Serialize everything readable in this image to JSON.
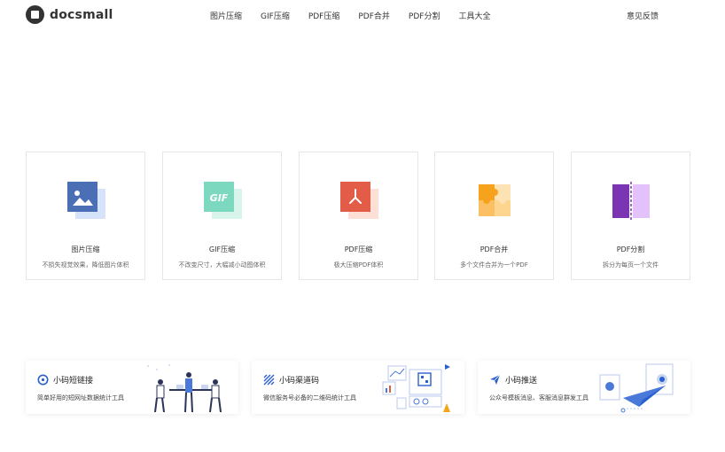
{
  "header": {
    "logo_text": "docsmall",
    "nav": [
      "图片压缩",
      "GIF压缩",
      "PDF压缩",
      "PDF合并",
      "PDF分割",
      "工具大全"
    ],
    "feedback": "意见反馈"
  },
  "tools": [
    {
      "title": "图片压缩",
      "desc": "不损失视觉效果，降低图片体积",
      "icon": "image-icon",
      "color": "#4a6fb5"
    },
    {
      "title": "GIF压缩",
      "desc": "不改变尺寸，大幅减小动图体积",
      "icon": "gif-icon",
      "icon_text": "GIF",
      "color": "#7dd8c0"
    },
    {
      "title": "PDF压缩",
      "desc": "极大压缩PDF体积",
      "icon": "pdf-icon",
      "color": "#e25c48"
    },
    {
      "title": "PDF合并",
      "desc": "多个文件合并为一个PDF",
      "icon": "puzzle-icon",
      "color": "#f7a21c"
    },
    {
      "title": "PDF分割",
      "desc": "拆分为每页一个文件",
      "icon": "split-icon",
      "color": "#7b35b3"
    }
  ],
  "promos": [
    {
      "title": "小码短链接",
      "desc": "简单好用的短网址数据统计工具",
      "icon": "link-icon"
    },
    {
      "title": "小码渠道码",
      "desc": "微信服务号必备的二维码统计工具",
      "icon": "qrcode-icon"
    },
    {
      "title": "小码推送",
      "desc": "公众号模板消息、客服消息群发工具",
      "icon": "paper-plane-icon"
    }
  ]
}
